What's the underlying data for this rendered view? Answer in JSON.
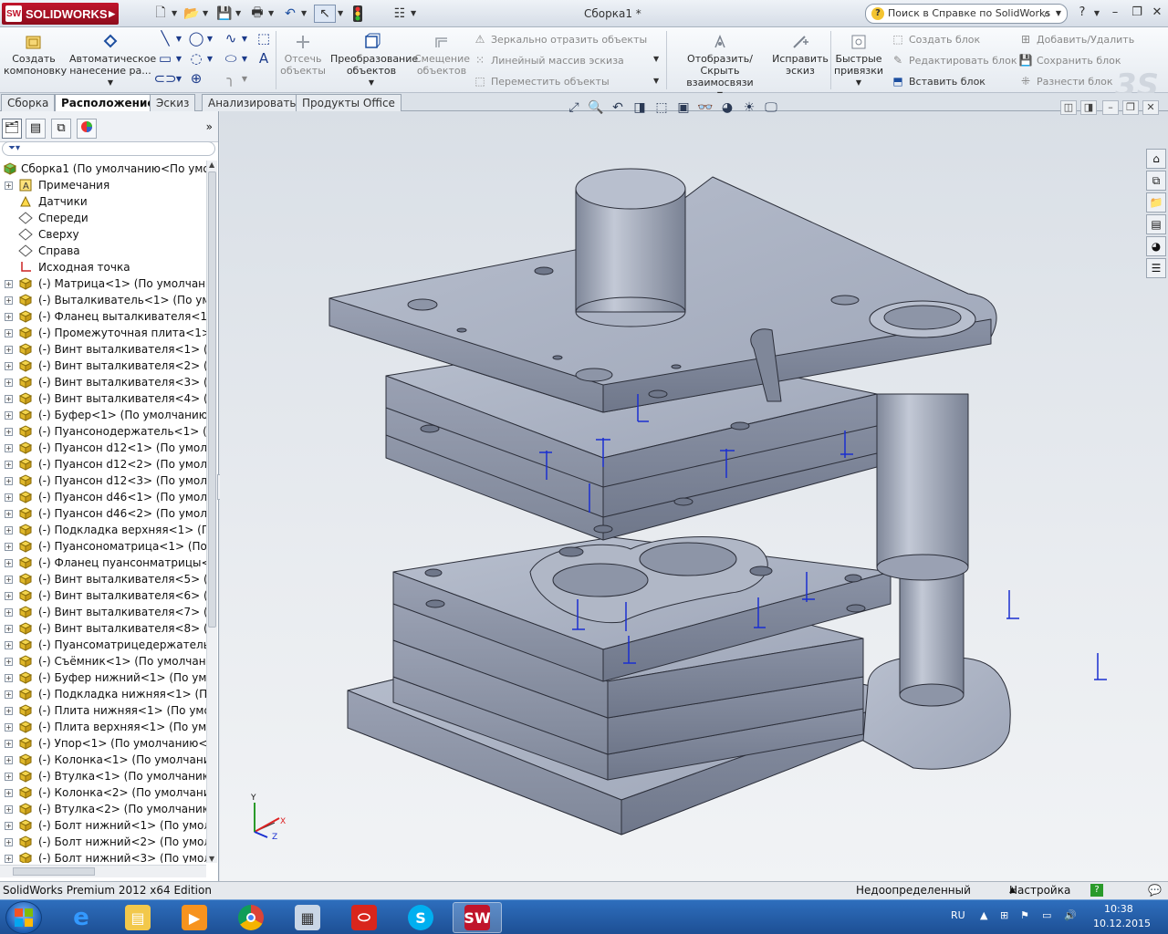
{
  "app": {
    "logo_text": "SOLIDWORKS",
    "document_title": "Сборка1 *",
    "help_search_placeholder": "Поиск в Справке по SolidWorks"
  },
  "ribbon": {
    "create_layout": "Создать компоновку",
    "auto_annotation": "Автоматическое нанесение ра...",
    "trim": "Отсечь объекты",
    "convert": "Преобразование объектов",
    "offset": "Смещение объектов",
    "mirror": "Зеркально отразить объекты",
    "linear_pattern": "Линейный массив эскиза",
    "move": "Переместить объекты",
    "show_hide_relations": "Отобразить/Скрыть взаимосвязи",
    "repair_sketch": "Исправить эскиз",
    "quick_snaps": "Быстрые привязки",
    "create_block": "Создать блок",
    "edit_block": "Редактировать блок",
    "insert_block": "Вставить блок",
    "add_remove": "Добавить/Удалить",
    "save_block": "Сохранить блок",
    "explode_block": "Разнести блок"
  },
  "tabs": [
    {
      "label": "Сборка",
      "active": false
    },
    {
      "label": "Расположение",
      "active": true
    },
    {
      "label": "Эскиз",
      "active": false
    },
    {
      "label": "Анализировать",
      "active": false
    },
    {
      "label": "Продукты Office",
      "active": false
    }
  ],
  "tree": {
    "root": "Сборка1  (По умолчанию<По умолч",
    "items": [
      {
        "label": "Примечания",
        "icon": "annotations-icon",
        "expand": true
      },
      {
        "label": "Датчики",
        "icon": "sensor-icon",
        "expand": false
      },
      {
        "label": "Спереди",
        "icon": "plane-icon",
        "expand": false
      },
      {
        "label": "Сверху",
        "icon": "plane-icon",
        "expand": false
      },
      {
        "label": "Справа",
        "icon": "plane-icon",
        "expand": false
      },
      {
        "label": "Исходная точка",
        "icon": "origin-icon",
        "expand": false
      },
      {
        "label": "(-) Матрица<1> (По умолчанию",
        "icon": "part-icon",
        "expand": true
      },
      {
        "label": "(-) Выталкиватель<1> (По умолч",
        "icon": "part-icon",
        "expand": true
      },
      {
        "label": "(-) Фланец выталкивателя<1> (П",
        "icon": "part-icon",
        "expand": true
      },
      {
        "label": "(-) Промежуточная плита<1> (П",
        "icon": "part-icon",
        "expand": true
      },
      {
        "label": "(-) Винт выталкивателя<1> (По у",
        "icon": "part-icon",
        "expand": true
      },
      {
        "label": "(-) Винт выталкивателя<2> (По у",
        "icon": "part-icon",
        "expand": true
      },
      {
        "label": "(-) Винт выталкивателя<3> (По у",
        "icon": "part-icon",
        "expand": true
      },
      {
        "label": "(-) Винт выталкивателя<4> (По у",
        "icon": "part-icon",
        "expand": true
      },
      {
        "label": "(-) Буфер<1> (По умолчанию<<",
        "icon": "part-icon",
        "expand": true
      },
      {
        "label": "(-) Пуансонодержатель<1> (По у",
        "icon": "part-icon",
        "expand": true
      },
      {
        "label": "(-) Пуансон d12<1> (По умолчан",
        "icon": "part-icon",
        "expand": true
      },
      {
        "label": "(-) Пуансон d12<2> (По умолчан",
        "icon": "part-icon",
        "expand": true
      },
      {
        "label": "(-) Пуансон d12<3> (По умолчан",
        "icon": "part-icon",
        "expand": true
      },
      {
        "label": "(-) Пуансон d46<1> (По умолчан",
        "icon": "part-icon",
        "expand": true
      },
      {
        "label": "(-) Пуансон d46<2> (По умолчан",
        "icon": "part-icon",
        "expand": true
      },
      {
        "label": "(-) Подкладка верхняя<1> (По ум",
        "icon": "part-icon",
        "expand": true
      },
      {
        "label": "(-) Пуансономатрица<1> (По ум",
        "icon": "part-icon",
        "expand": true
      },
      {
        "label": "(-) Фланец пуансонматрицы<1> ",
        "icon": "part-icon",
        "expand": true
      },
      {
        "label": "(-) Винт выталкивателя<5> (По у",
        "icon": "part-icon",
        "expand": true
      },
      {
        "label": "(-) Винт выталкивателя<6> (По у",
        "icon": "part-icon",
        "expand": true
      },
      {
        "label": "(-) Винт выталкивателя<7> (По у",
        "icon": "part-icon",
        "expand": true
      },
      {
        "label": "(-) Винт выталкивателя<8> (По у",
        "icon": "part-icon",
        "expand": true
      },
      {
        "label": "(-) Пуансоматрицедержатель<1>",
        "icon": "part-icon",
        "expand": true
      },
      {
        "label": "(-) Съёмник<1> (По умолчанию",
        "icon": "part-icon",
        "expand": true
      },
      {
        "label": "(-) Буфер нижний<1> (По умолч",
        "icon": "part-icon",
        "expand": true
      },
      {
        "label": "(-) Подкладка нижняя<1> (По ум",
        "icon": "part-icon",
        "expand": true
      },
      {
        "label": "(-) Плита нижняя<1> (По умолча",
        "icon": "part-icon",
        "expand": true
      },
      {
        "label": "(-) Плита верхняя<1> (По умолч",
        "icon": "part-icon",
        "expand": true
      },
      {
        "label": "(-) Упор<1> (По умолчанию<<П",
        "icon": "part-icon",
        "expand": true
      },
      {
        "label": "(-) Колонка<1> (По умолчанию<",
        "icon": "part-icon",
        "expand": true
      },
      {
        "label": "(-) Втулка<1> (По умолчанию<<",
        "icon": "part-icon",
        "expand": true
      },
      {
        "label": "(-) Колонка<2> (По умолчанию<",
        "icon": "part-icon",
        "expand": true
      },
      {
        "label": "(-) Втулка<2> (По умолчанию<<",
        "icon": "part-icon",
        "expand": true
      },
      {
        "label": "(-) Болт нижний<1> (По умолча",
        "icon": "part-icon",
        "expand": true
      },
      {
        "label": "(-) Болт нижний<2> (По умолча",
        "icon": "part-icon",
        "expand": true
      },
      {
        "label": "(-) Болт нижний<3> (По умолча",
        "icon": "part-icon",
        "expand": true
      }
    ]
  },
  "triad": {
    "x": "X",
    "y": "Y",
    "z": "Z"
  },
  "status": {
    "edition": "SolidWorks Premium 2012 x64 Edition",
    "state": "Недоопределенный",
    "settings": "Настройка"
  },
  "taskbar": {
    "lang": "RU",
    "time": "10:38",
    "date": "10.12.2015"
  },
  "colors": {
    "model_face": "#a7aebf",
    "model_edge": "#2c2f3a",
    "selection_blue": "#1a2fd0"
  }
}
